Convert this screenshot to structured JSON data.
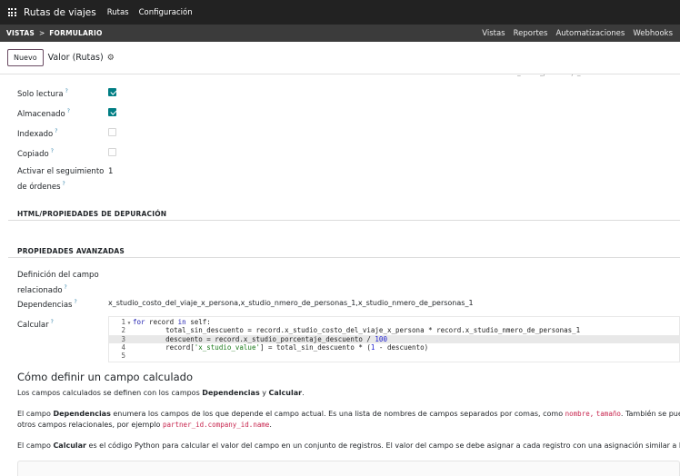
{
  "navbar": {
    "app_icon": "apps-grid-icon",
    "brand": "Rutas de viajes",
    "menu": [
      "Rutas",
      "Configuración"
    ]
  },
  "studio": {
    "breadcrumb": [
      "VISTAS",
      "FORMULARIO"
    ],
    "separator": ">",
    "actions": [
      "Vistas",
      "Reportes",
      "Automatizaciones",
      "Webhooks"
    ]
  },
  "control": {
    "new_label": "Nuevo",
    "title": "Valor (Rutas)",
    "gear_icon": "gear-icon"
  },
  "fields": {
    "top_cut_value": "x_studio_porcentaje_descuento",
    "readonly": {
      "label": "Solo lectura",
      "help": "?",
      "checked": true
    },
    "stored": {
      "label": "Almacenado",
      "help": "?",
      "checked": true
    },
    "indexed": {
      "label": "Indexado",
      "help": "?",
      "checked": false
    },
    "copied": {
      "label": "Copiado",
      "help": "?",
      "checked": false
    },
    "tracking": {
      "label_line1": "Activar el seguimiento",
      "label_line2": "de órdenes",
      "help": "?",
      "value": "1"
    }
  },
  "sections": {
    "debug": "HTML/PROPIEDADES DE DEPURACIÓN",
    "advanced": "PROPIEDADES AVANZADAS"
  },
  "advanced": {
    "related": {
      "label_line1": "Definición del campo",
      "label_line2": "relacionado",
      "help": "?"
    },
    "depends": {
      "label": "Dependencias",
      "help": "?",
      "value": "x_studio_costo_del_viaje_x_persona,x_studio_nmero_de_personas_1,x_studio_nmero_de_personas_1"
    },
    "compute": {
      "label": "Calcular",
      "help": "?"
    }
  },
  "code": {
    "line_numbers": [
      "1",
      "2",
      "3",
      "4",
      "5"
    ],
    "active_line": 3,
    "l1_kw": "for",
    "l1_a": " record ",
    "l1_kw2": "in",
    "l1_b": " self:",
    "l2": "        total_sin_descuento = record.x_studio_costo_del_viaje_x_persona * record.x_studio_nmero_de_personas_1",
    "l3_a": "        descuento = record.x_studio_porcentaje_descuento / ",
    "l3_num": "100",
    "l4_a": "        record[",
    "l4_str": "'x_studio_value'",
    "l4_b": "] = total_sin_descuento * (",
    "l4_num": "1",
    "l4_c": " - descuento)"
  },
  "help": {
    "title": "Cómo definir un campo calculado",
    "p1_a": "Los campos calculados se definen con los campos ",
    "p1_b": "Dependencias",
    "p1_c": " y ",
    "p1_d": "Calcular",
    "p1_e": ".",
    "p2_a": "El campo ",
    "p2_b": "Dependencias",
    "p2_c": " enumera los campos de los que depende el campo actual. Es una lista de nombres de campos separados por comas, como ",
    "p2_code1": "nombre,",
    "p2_code2": "tamaño",
    "p2_d": ". También se puede refe",
    "p3_a": "otros campos relacionales, por ejemplo ",
    "p3_code": "partner_id.company_id.name",
    "p3_b": ".",
    "p4_a": "El campo ",
    "p4_b": "Calcular",
    "p4_c": " es el código Python para calcular el valor del campo en un conjunto de registros. El valor del campo se debe asignar a cada registro con una asignación similar a la de un di"
  }
}
